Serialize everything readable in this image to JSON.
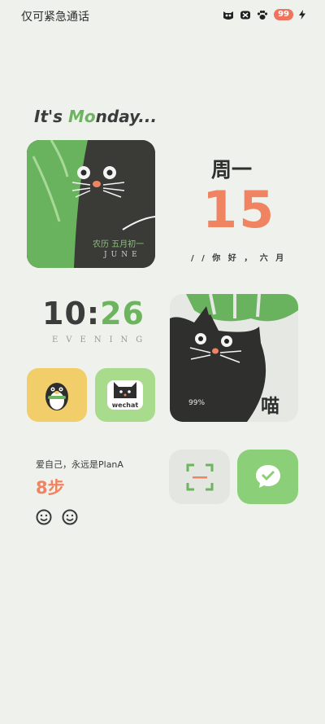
{
  "status_bar": {
    "carrier_text": "仅可紧急通话",
    "battery_level": "99",
    "icons": [
      "cat-face-icon",
      "mouse-icon",
      "paw-icon",
      "charging-bolt-icon"
    ]
  },
  "header": {
    "prefix": "It's ",
    "highlight": "Mo",
    "suffix": "nday..."
  },
  "cat_widget": {
    "lunar_date": "农历 五月初一",
    "month_en": "JUNE"
  },
  "date_widget": {
    "weekday": "周一",
    "day": "15",
    "greeting": "/ / 你 好 ， 六 月"
  },
  "clock": {
    "hours": "10",
    "separator": ":",
    "minutes": "26",
    "period": "EVENING"
  },
  "apps": {
    "qq_icon": "penguin-icon",
    "wechat_label": "wechat"
  },
  "battery_widget": {
    "percent": "99%",
    "cat_text": "喵"
  },
  "steps_widget": {
    "motto": "爱自己，永远是PlanA",
    "steps": "8步"
  },
  "bottom_apps": {
    "scan_icon": "scan-icon",
    "wechat_icon": "wechat-icon"
  },
  "colors": {
    "background": "#eff1ec",
    "accent_green": "#6cb55e",
    "accent_orange": "#ef8362",
    "dark": "#3a3a37"
  }
}
